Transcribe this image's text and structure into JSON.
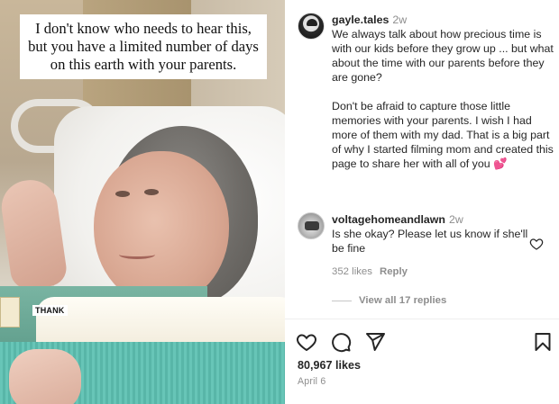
{
  "media": {
    "caption": "I don't know who needs to hear this, but you have a limited number of days on this earth with your parents.",
    "sticker_text": "THANK"
  },
  "post": {
    "username": "gayle.tales",
    "time": "2w",
    "paragraph1": "We always talk about how precious time is with our kids before they grow up ... but what about the time with our parents before they are gone?",
    "paragraph2": "Don't be afraid to capture those little memories with your parents. I wish I had more of them with my dad. That is a big part of why I started filming mom and created this page to share her with all of you",
    "emoji": "💕"
  },
  "comment": {
    "username": "voltagehomeandlawn",
    "time": "2w",
    "text": "Is she okay? Please let us know if she'll be fine",
    "likes": "352 likes",
    "reply_label": "Reply",
    "view_replies": "View all 17 replies"
  },
  "footer": {
    "likes": "80,967 likes",
    "date": "April 6"
  },
  "icons": [
    "heart-icon",
    "comment-icon",
    "share-icon",
    "bookmark-icon",
    "small-heart-icon"
  ]
}
